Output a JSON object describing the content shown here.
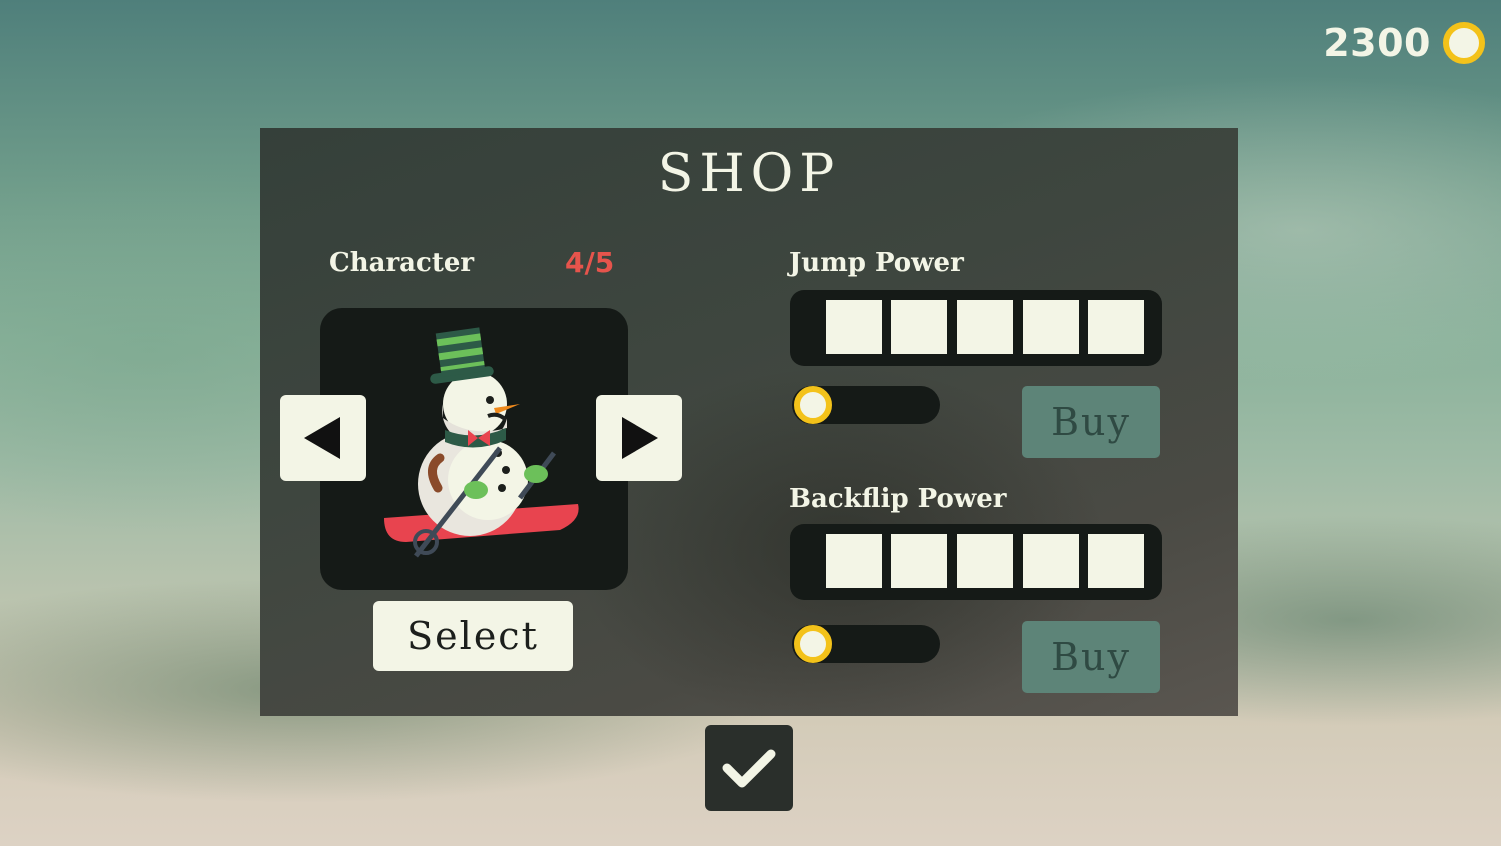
{
  "wallet": {
    "coins": "2300",
    "coin_icon": "coin-icon"
  },
  "shop": {
    "title": "SHOP",
    "character": {
      "label": "Character",
      "count": "4/5",
      "preview_icon": "snowman-skier-icon",
      "prev_icon": "arrow-left-icon",
      "next_icon": "arrow-right-icon",
      "select_label": "Select"
    },
    "upgrades": [
      {
        "label": "Jump Power",
        "segments_total": 5,
        "segments_filled": 0,
        "buy_label": "Buy",
        "progress": 0
      },
      {
        "label": "Backflip Power",
        "segments_total": 5,
        "segments_filled": 0,
        "buy_label": "Buy",
        "progress": 0
      }
    ],
    "confirm_icon": "checkmark-icon"
  },
  "colors": {
    "accent_gold": "#f3c21a",
    "count_red": "#e6544c",
    "cream": "#f3f5e6",
    "buy_disabled": "#5d8478",
    "panel_dark": "#151a17"
  }
}
